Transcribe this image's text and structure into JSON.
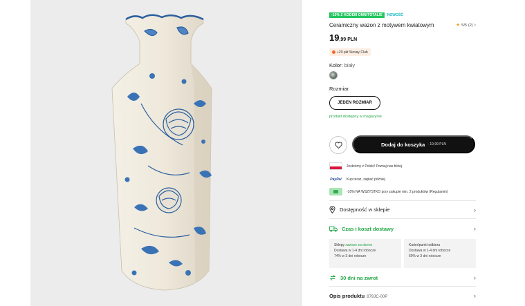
{
  "product": {
    "badge_promo": "-10% Z KODEM OMNITOTALIE",
    "badge_new": "NOWOŚĆ",
    "title": "Ceramiczny wazon z motywem kwiatowym",
    "rating": "5/5",
    "rating_count": "(2)",
    "rating_value": 5,
    "price_int": "19",
    "price_dec": ",99",
    "price_currency": "PLN",
    "club_text": "+20 pkt Sinsay Club",
    "color_label": "Kolor:",
    "color_value": "biały",
    "size_label": "Rozmiar",
    "size_option": "JEDEN ROZMIAR",
    "stock_text": "produkt dostępny w magazynie",
    "add_to_cart": "Dodaj do koszyka",
    "add_to_cart_price": "- 19,99 PLN"
  },
  "info": {
    "made_in": "Jesteśmy z Polski! Poznaj nas bliżej",
    "paypal_logo": "PayPal",
    "paypal": "Kup teraz, zapłać później",
    "promo": "-10% NA WSZYSTKO przy zakupie min. 2 produktów (Regulamin)"
  },
  "rows": {
    "availability": "Dostępność w sklepie",
    "delivery": "Czas i koszt dostawy",
    "returns": "30 dni na zwrot",
    "description": "Opis produktu",
    "product_code": "879JC-00P"
  },
  "delivery": {
    "stores_title": "Sklepy",
    "stores_free": "zawsze za darmo",
    "stores_line1": "Dostawa w 1-4 dni robocze",
    "stores_line2": "74% w 3 dni robocze",
    "courier_title": "Kurier/punkt odbioru",
    "courier_line1": "Dostawa w 1-4 dni robocze",
    "courier_line2": "69% w 3 dni robocze"
  },
  "colors": {
    "promo_green": "#22c55e",
    "new_teal": "#10b8c4",
    "stock_green": "#22a845",
    "cart_black": "#111111",
    "vase_blue": "#2b5f9e",
    "vase_cream": "#f1ece0"
  }
}
